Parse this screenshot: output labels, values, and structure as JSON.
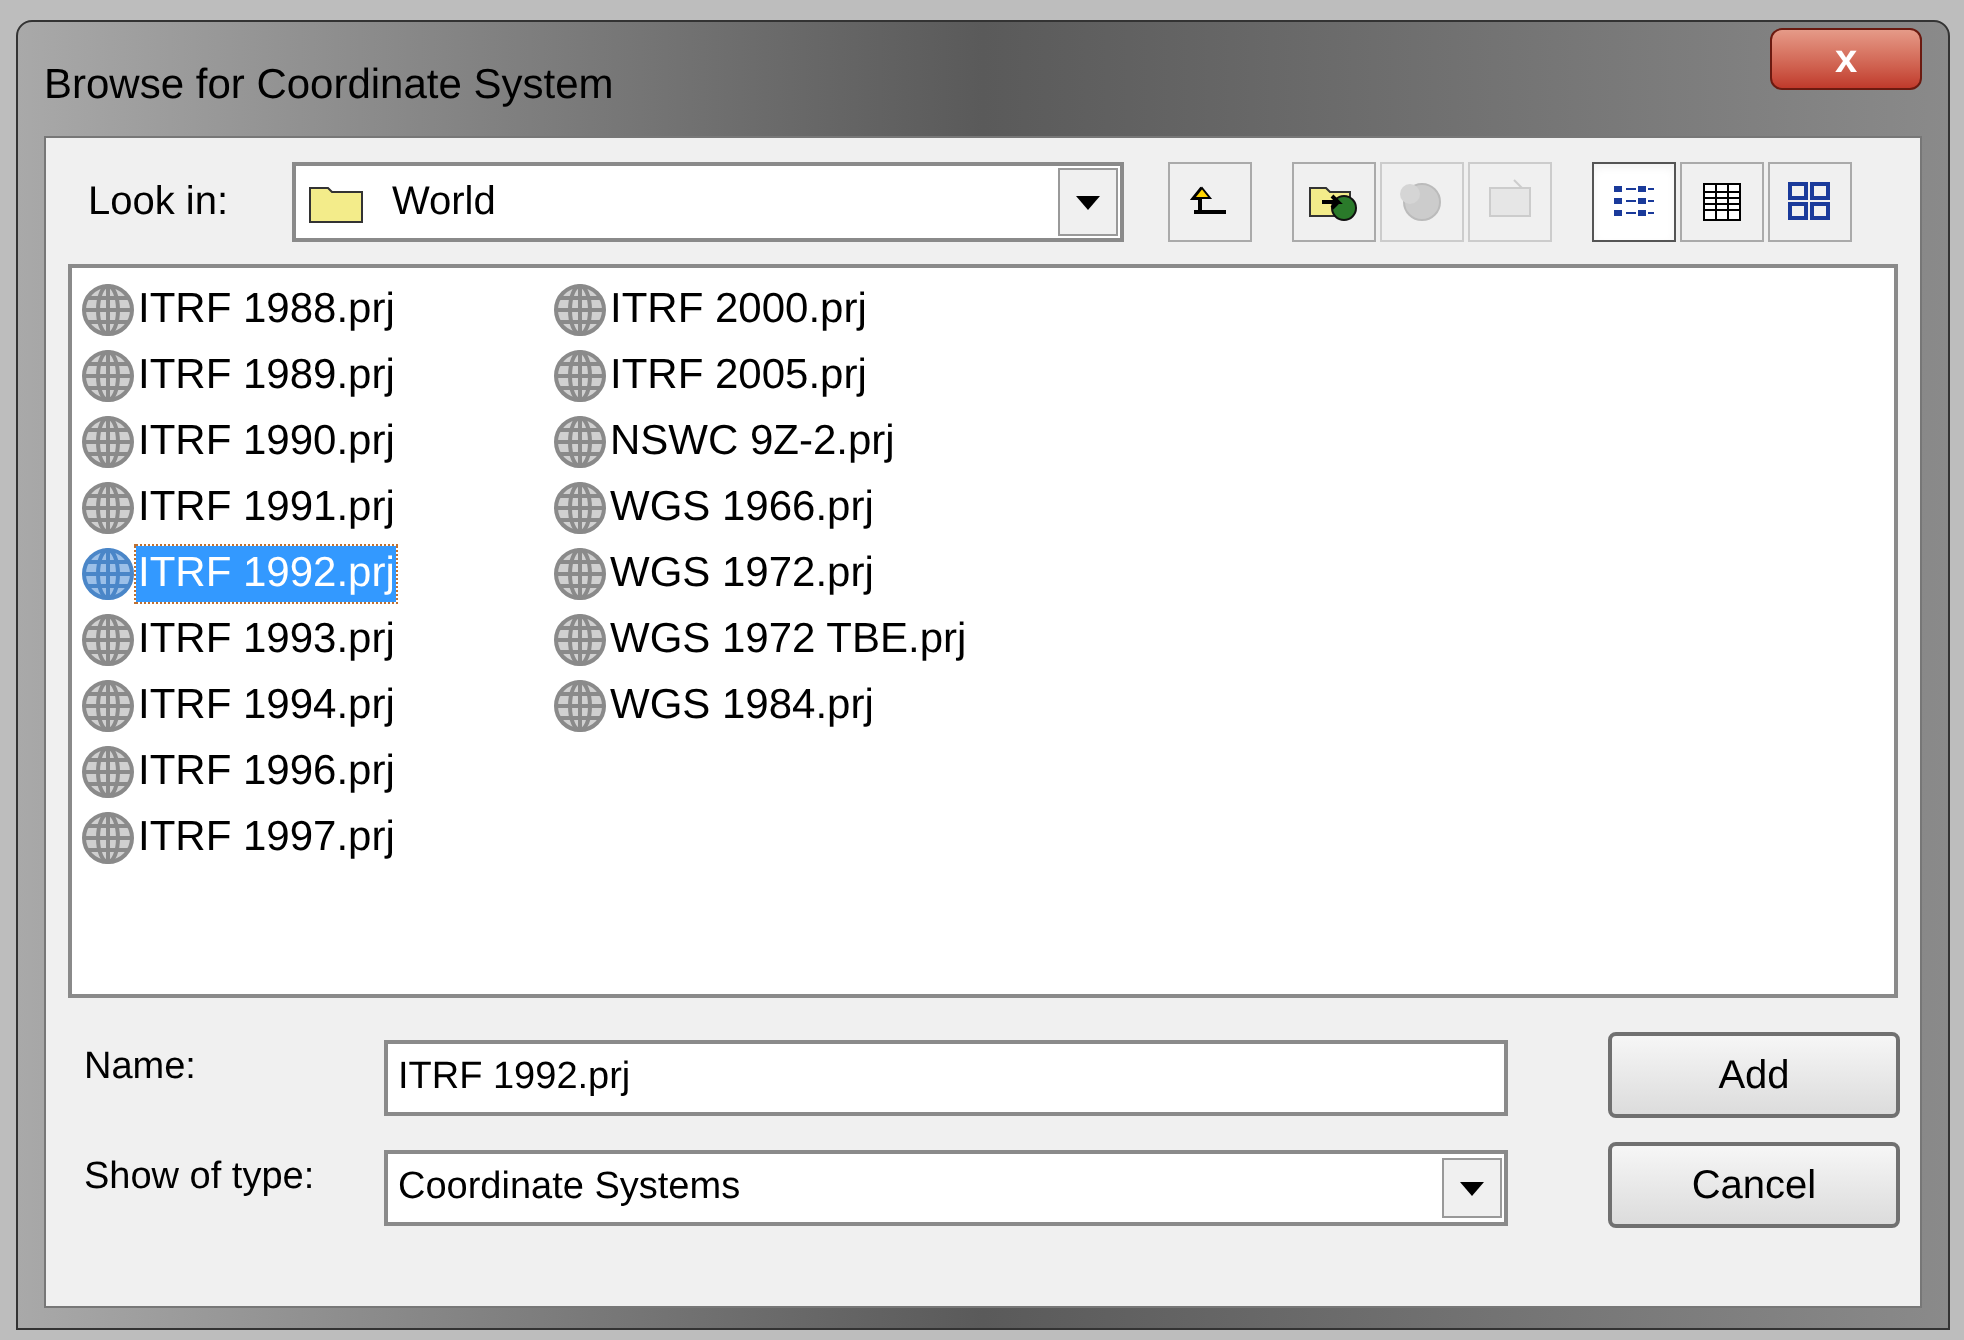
{
  "window": {
    "title": "Browse for Coordinate System",
    "close": "x"
  },
  "look_in": {
    "label": "Look in:",
    "value": "World"
  },
  "toolbar": [
    {
      "kind": "up",
      "disabled": false,
      "selected": false
    },
    {
      "kind": "connect",
      "disabled": false,
      "selected": false
    },
    {
      "kind": "disconnect",
      "disabled": true,
      "selected": false
    },
    {
      "kind": "new",
      "disabled": true,
      "selected": false
    },
    {
      "kind": "list",
      "disabled": false,
      "selected": true
    },
    {
      "kind": "details",
      "disabled": false,
      "selected": false
    },
    {
      "kind": "thumbnails",
      "disabled": false,
      "selected": false
    }
  ],
  "files": [
    {
      "label": "ITRF 1988.prj",
      "selected": false
    },
    {
      "label": "ITRF 1989.prj",
      "selected": false
    },
    {
      "label": "ITRF 1990.prj",
      "selected": false
    },
    {
      "label": "ITRF 1991.prj",
      "selected": false
    },
    {
      "label": "ITRF 1992.prj",
      "selected": true
    },
    {
      "label": "ITRF 1993.prj",
      "selected": false
    },
    {
      "label": "ITRF 1994.prj",
      "selected": false
    },
    {
      "label": "ITRF 1996.prj",
      "selected": false
    },
    {
      "label": "ITRF 1997.prj",
      "selected": false
    },
    {
      "label": "ITRF 2000.prj",
      "selected": false
    },
    {
      "label": "ITRF 2005.prj",
      "selected": false
    },
    {
      "label": "NSWC 9Z-2.prj",
      "selected": false
    },
    {
      "label": "WGS 1966.prj",
      "selected": false
    },
    {
      "label": "WGS 1972.prj",
      "selected": false
    },
    {
      "label": "WGS 1972 TBE.prj",
      "selected": false
    },
    {
      "label": "WGS 1984.prj",
      "selected": false
    }
  ],
  "name_field": {
    "label": "Name:",
    "value": "ITRF 1992.prj"
  },
  "type_field": {
    "label": "Show of type:",
    "value": "Coordinate Systems"
  },
  "buttons": [
    "Add",
    "Cancel"
  ]
}
